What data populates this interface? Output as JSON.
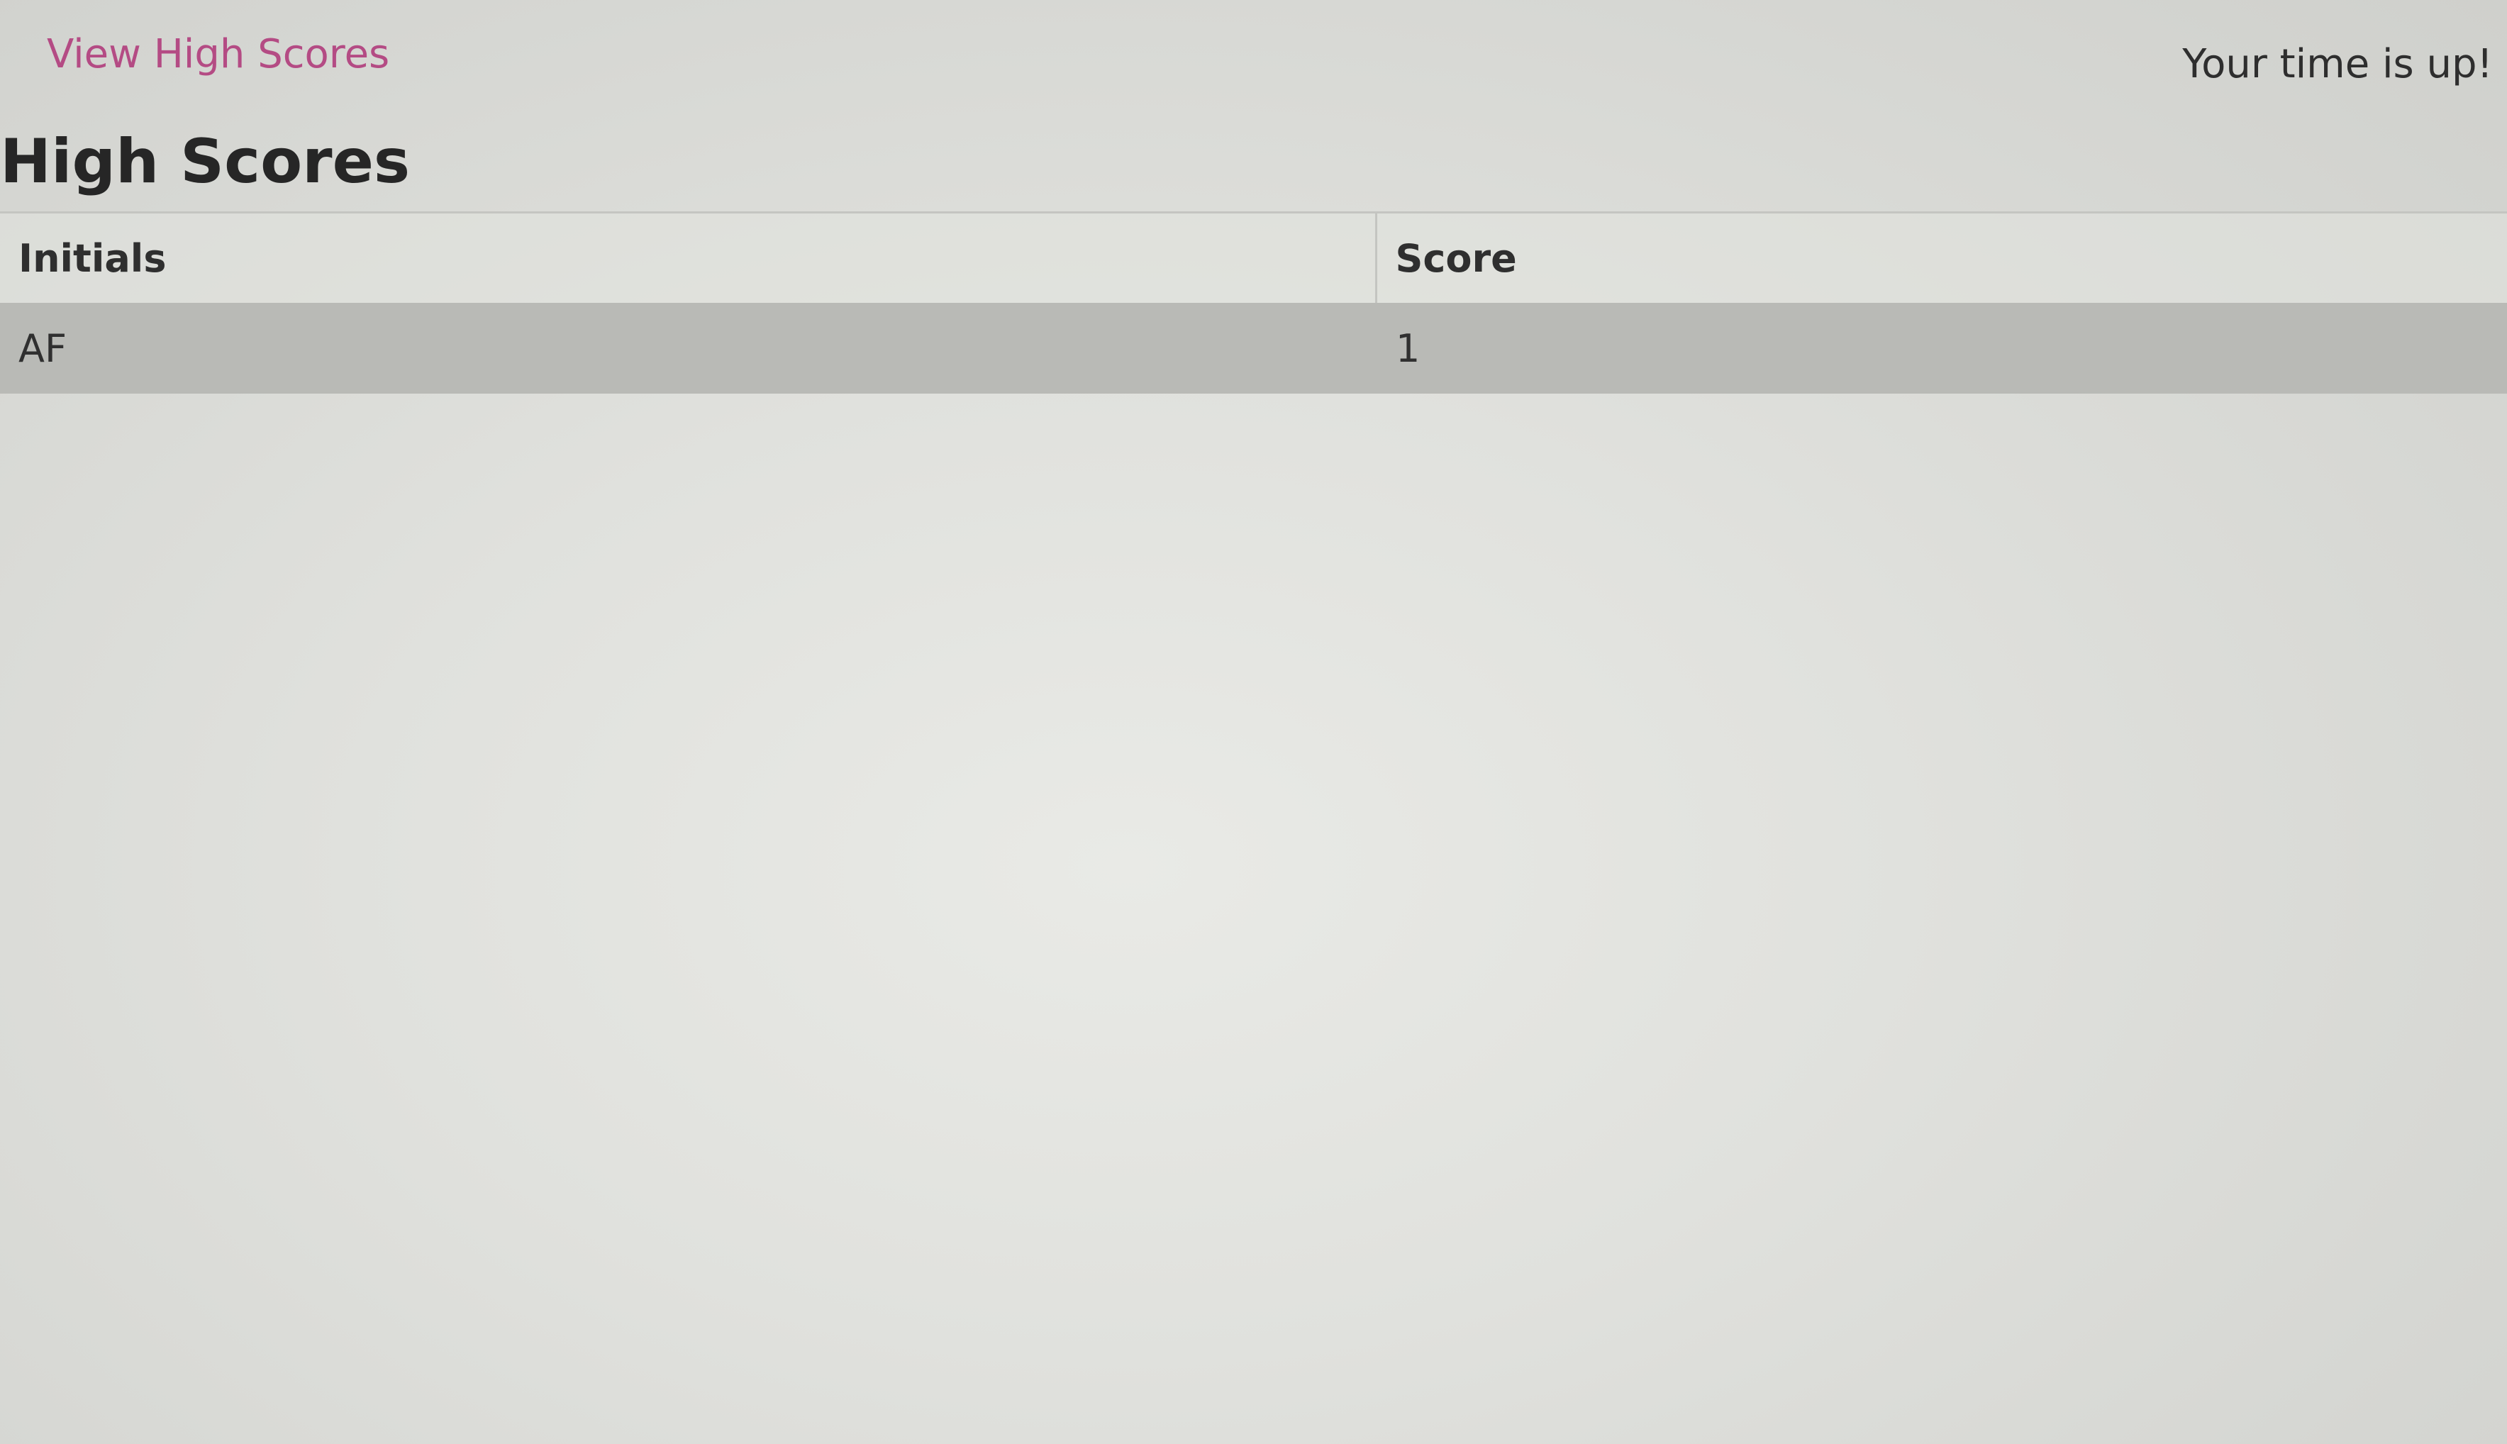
{
  "header": {
    "view_high_scores_label": "View High Scores",
    "timer_message": "Your time is up!"
  },
  "main": {
    "title": "High Scores",
    "table": {
      "columns": [
        "Initials",
        "Score"
      ],
      "rows": [
        {
          "initials": "AF",
          "score": "1"
        }
      ]
    }
  },
  "colors": {
    "link": "#b44b84",
    "row_background": "#b9bab6",
    "page_background": "#e0e1dd"
  }
}
